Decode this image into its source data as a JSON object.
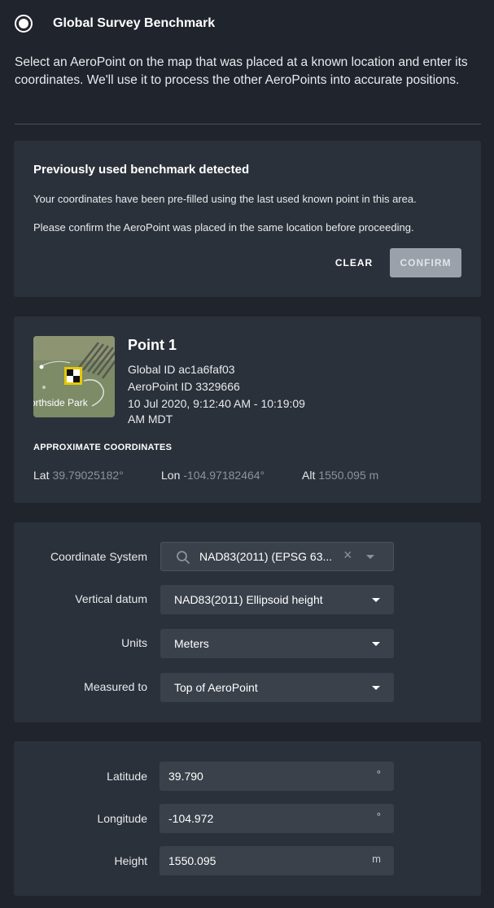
{
  "header": {
    "title": "Global Survey Benchmark",
    "description": "Select an AeroPoint on the map that was placed at a known location and enter its coordinates. We'll use it to process the other AeroPoints into accurate positions."
  },
  "benchmark_notice": {
    "title": "Previously used benchmark detected",
    "line1": "Your coordinates have been pre-filled using the last used known point in this area.",
    "line2": "Please confirm the AeroPoint was placed in the same location before proceeding.",
    "clear_label": "CLEAR",
    "confirm_label": "CONFIRM"
  },
  "point": {
    "title": "Point 1",
    "global_id": "Global ID ac1a6faf03",
    "aeropoint_id": "AeroPoint ID 3329666",
    "time_line1": "10 Jul 2020, 9:12:40 AM - 10:19:09",
    "time_line2": "AM MDT",
    "thumb_label": "orthside Park",
    "approx_label": "APPROXIMATE COORDINATES",
    "lat_label": "Lat",
    "lat_value": "39.79025182°",
    "lon_label": "Lon",
    "lon_value": "-104.97182464°",
    "alt_label": "Alt",
    "alt_value": "1550.095 m"
  },
  "settings": {
    "coordinate_system_label": "Coordinate System",
    "coordinate_system_value": "NAD83(2011) (EPSG 63...",
    "vertical_datum_label": "Vertical datum",
    "vertical_datum_value": "NAD83(2011) Ellipsoid height",
    "units_label": "Units",
    "units_value": "Meters",
    "measured_to_label": "Measured to",
    "measured_to_value": "Top of AeroPoint"
  },
  "coordinates": {
    "latitude_label": "Latitude",
    "latitude_value": "39.790",
    "latitude_unit": "°",
    "longitude_label": "Longitude",
    "longitude_value": "-104.972",
    "longitude_unit": "°",
    "height_label": "Height",
    "height_value": "1550.095",
    "height_unit": "m"
  },
  "icons": {
    "radio": "radio-selected-icon",
    "search": "search-icon",
    "clear": "close-icon",
    "dropdown": "caret-down-icon"
  },
  "colors": {
    "background": "#1f242d",
    "card": "#2b313b",
    "field": "#3a414b",
    "confirm_disabled": "#9aa1ab"
  }
}
